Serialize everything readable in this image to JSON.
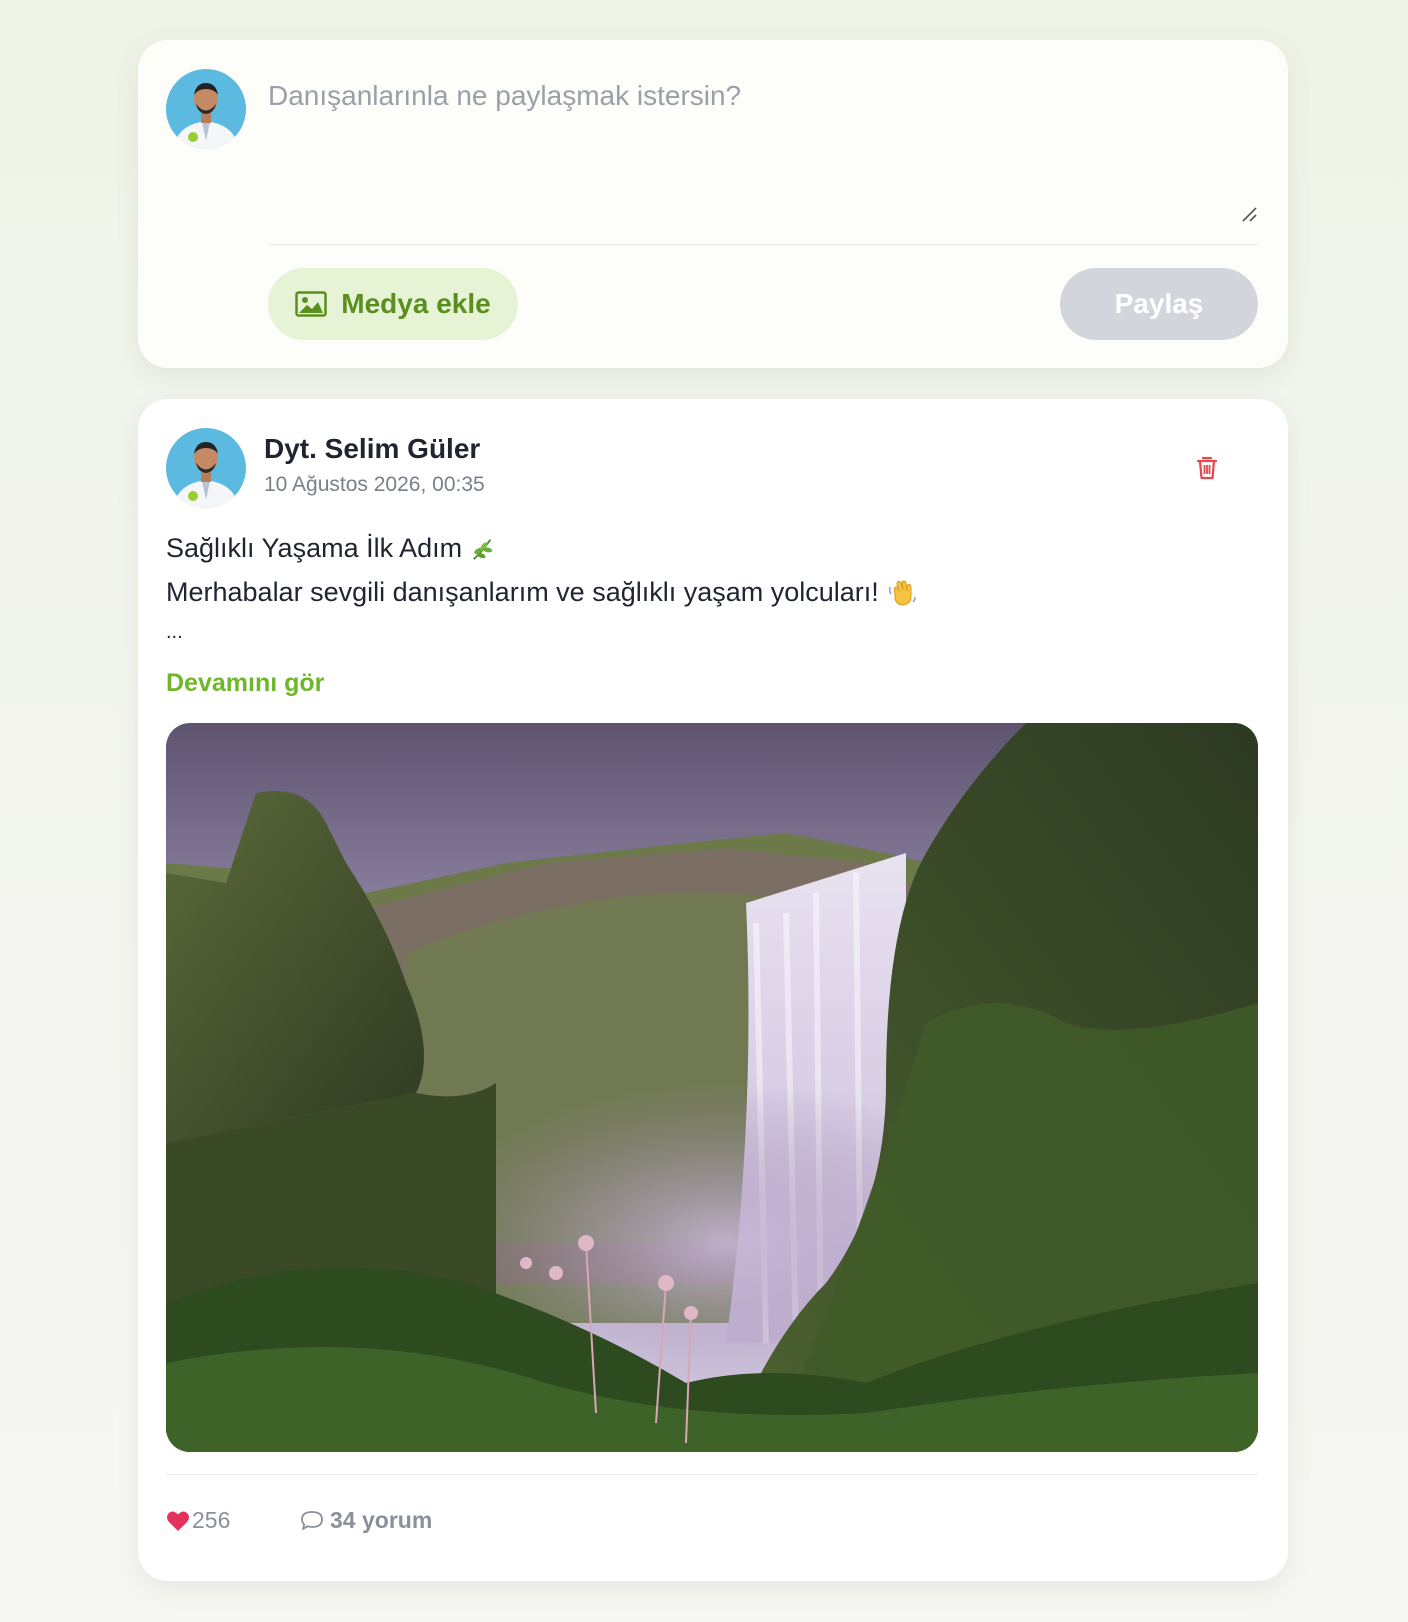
{
  "composer": {
    "placeholder": "Danışanlarınla ne paylaşmak istersin?",
    "media_label": "Medya ekle",
    "share_label": "Paylaş",
    "icons": {
      "media": "image-icon",
      "resize": "resize-handle-icon"
    }
  },
  "post": {
    "author": "Dyt. Selim Güler",
    "timestamp": "10 Ağustos 2026, 00:35",
    "title_line": "Sağlıklı Yaşama İlk Adım",
    "body_line": "Merhabalar sevgili danışanlarım ve sağlıklı yaşam yolcuları!",
    "ellipsis": "...",
    "read_more": "Devamını gör",
    "likes": "256",
    "comments": "34 yorum",
    "icons": {
      "delete": "trash-icon",
      "like": "heart-icon",
      "comment": "comment-icon",
      "title_emoji": "herb-icon",
      "body_emoji": "waving-hand-icon"
    }
  },
  "colors": {
    "accent_green": "#6fb72a",
    "media_button_bg": "#e6f3d4",
    "media_button_text": "#5a8f1f",
    "share_button_disabled": "#d2d6dc",
    "delete_red": "#e5484d",
    "heart_pink": "#e5325c"
  }
}
